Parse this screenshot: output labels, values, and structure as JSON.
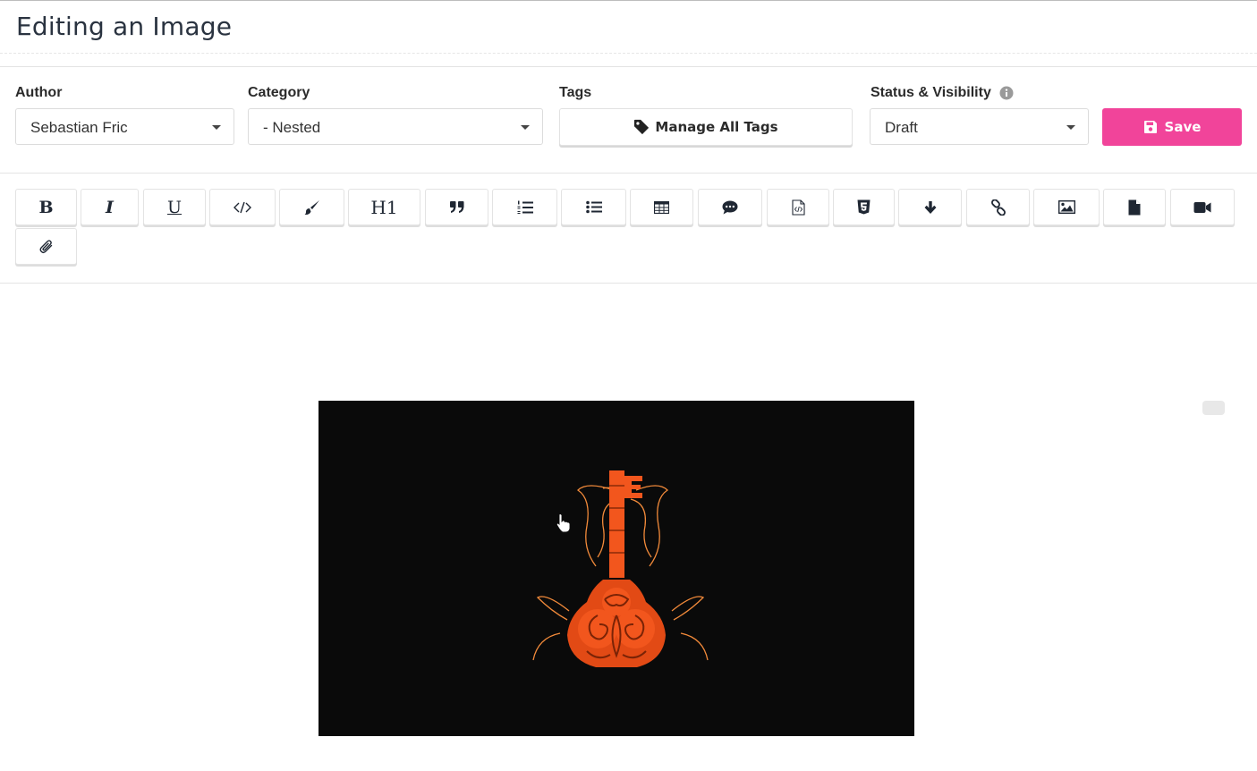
{
  "header": {
    "title": "Editing an Image"
  },
  "fields": {
    "author": {
      "label": "Author",
      "value": "Sebastian Fric"
    },
    "category": {
      "label": "Category",
      "value": "- Nested"
    },
    "tags": {
      "label": "Tags",
      "button_label": "Manage All Tags"
    },
    "status": {
      "label": "Status & Visibility",
      "value": "Draft"
    }
  },
  "actions": {
    "save_label": "Save"
  },
  "toolbar": {
    "buttons": [
      {
        "name": "bold",
        "glyph": "B"
      },
      {
        "name": "italic",
        "glyph": "I"
      },
      {
        "name": "underline",
        "glyph": "U"
      },
      {
        "name": "code",
        "icon": "code-icon"
      },
      {
        "name": "highlight",
        "icon": "paint-brush-icon"
      },
      {
        "name": "heading",
        "glyph": "H1"
      },
      {
        "name": "quote",
        "icon": "quote-icon"
      },
      {
        "name": "ordered-list",
        "icon": "ordered-list-icon"
      },
      {
        "name": "unordered-list",
        "icon": "list-icon"
      },
      {
        "name": "table",
        "icon": "table-icon"
      },
      {
        "name": "comment",
        "icon": "comment-icon"
      },
      {
        "name": "code-file",
        "icon": "code-file-icon"
      },
      {
        "name": "html5",
        "icon": "html5-icon"
      },
      {
        "name": "arrow-down",
        "icon": "arrow-down-icon"
      },
      {
        "name": "link",
        "icon": "link-icon"
      },
      {
        "name": "image",
        "icon": "image-icon"
      },
      {
        "name": "file",
        "icon": "file-icon"
      },
      {
        "name": "video",
        "icon": "video-icon"
      },
      {
        "name": "attachment",
        "icon": "paperclip-icon"
      }
    ]
  },
  "colors": {
    "save_button": "#f1449a",
    "key_orange": "#f2561d",
    "image_background": "#0a0a0a"
  }
}
